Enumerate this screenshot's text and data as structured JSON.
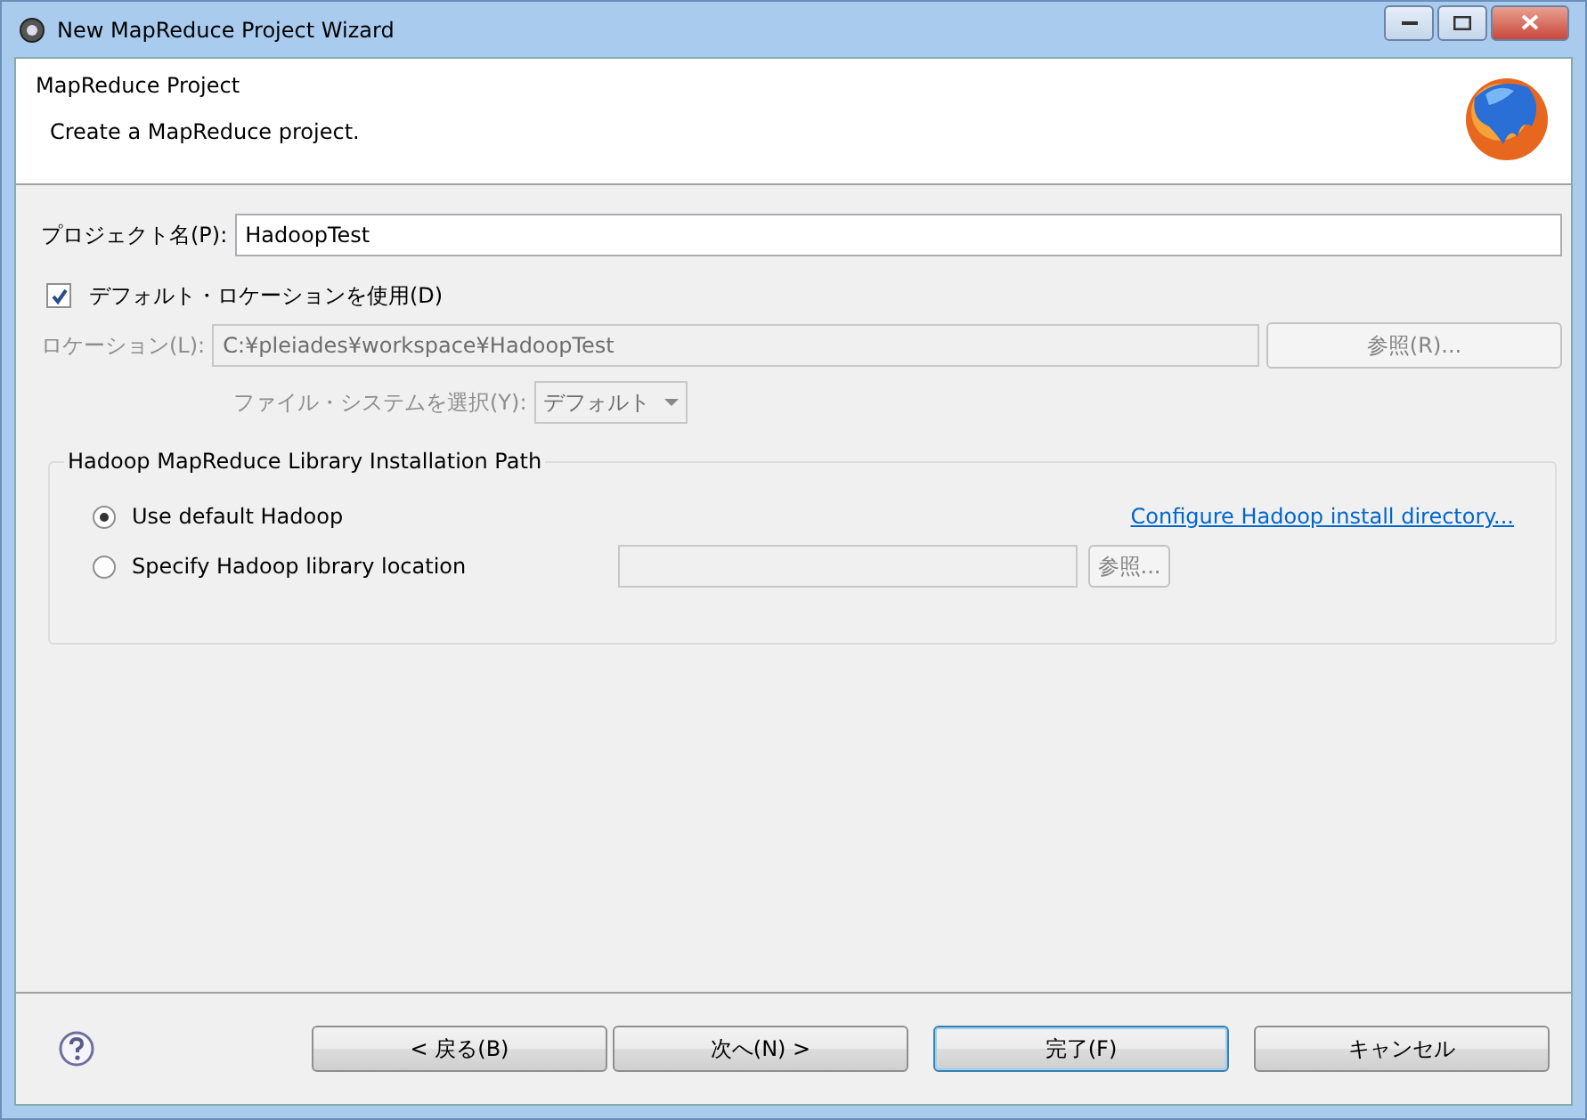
{
  "window": {
    "title": "New MapReduce Project Wizard"
  },
  "header": {
    "title": "MapReduce Project",
    "description": "Create a MapReduce project."
  },
  "project_name": {
    "label": "プロジェクト名(P):",
    "value": "HadoopTest"
  },
  "use_default_location": {
    "label": "デフォルト・ロケーションを使用(D)",
    "checked": true
  },
  "location": {
    "label": "ロケーション(L):",
    "value": "C:¥pleiades¥workspace¥HadoopTest",
    "button": "参照(R)...",
    "disabled": true
  },
  "file_system": {
    "label": "ファイル・システムを選択(Y):",
    "value": "デフォルト",
    "disabled": true
  },
  "hadoop_group": {
    "title": "Hadoop MapReduce Library Installation Path",
    "options": [
      {
        "label": "Use default Hadoop",
        "selected": true,
        "link": "Configure Hadoop install directory..."
      },
      {
        "label": "Specify Hadoop library location",
        "selected": false,
        "button": "参照..."
      }
    ]
  },
  "buttons": [
    {
      "label": "< 戻る(B)",
      "default": false
    },
    {
      "label": "次へ(N) >",
      "default": false
    },
    {
      "label": "完了(F)",
      "default": true
    },
    {
      "label": "キャンセル",
      "default": false
    }
  ]
}
